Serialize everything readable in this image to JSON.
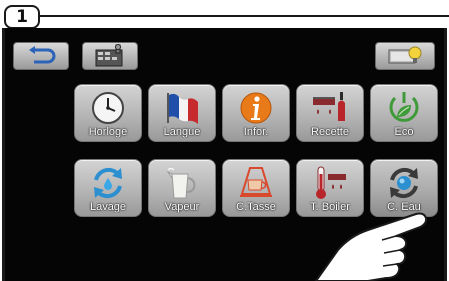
{
  "step_number": "1",
  "top_bar": {
    "back_icon": "back-arrow-icon",
    "settings_icon": "menu-settings-icon",
    "eco_icon": "eco-mode-icon"
  },
  "tiles_row1": [
    {
      "label": "Horloge",
      "icon": "clock-icon"
    },
    {
      "label": "Langue",
      "icon": "french-flag-icon"
    },
    {
      "label": "Infor.",
      "icon": "info-icon"
    },
    {
      "label": "Recette",
      "icon": "recipe-icon"
    },
    {
      "label": "Eco",
      "icon": "eco-power-icon"
    }
  ],
  "tiles_row2": [
    {
      "label": "Lavage",
      "icon": "rinse-icon"
    },
    {
      "label": "Vapeur",
      "icon": "steam-jug-icon"
    },
    {
      "label": "C.Tasse",
      "icon": "cup-heater-icon"
    },
    {
      "label": "T. Boiler",
      "icon": "boiler-temperature-icon"
    },
    {
      "label": "C. Eau",
      "icon": "water-filter-icon"
    }
  ],
  "colors": {
    "screen_bg": "#050505",
    "tile_top": "#d4d4d4",
    "tile_bottom": "#999999",
    "accent_red": "#b8252b",
    "accent_green": "#3f9a3a",
    "accent_orange": "#e97a1a",
    "accent_blue": "#2c8fd0"
  }
}
